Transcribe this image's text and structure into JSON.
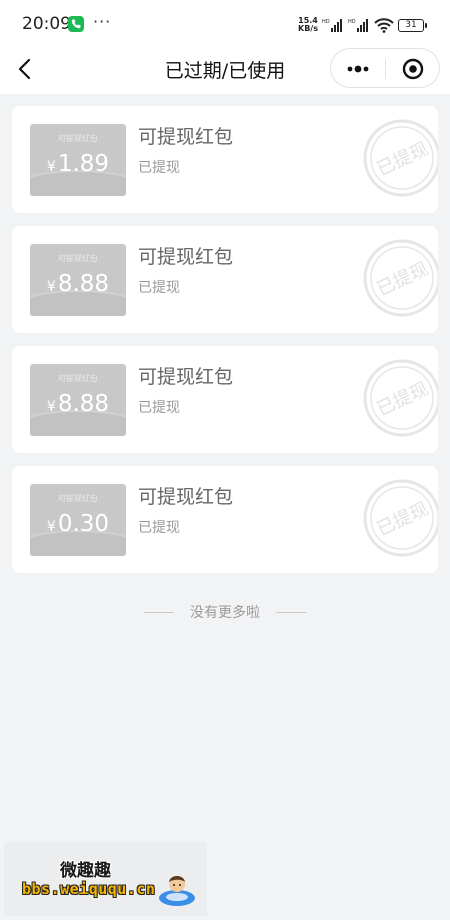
{
  "status_bar": {
    "time": "20:09",
    "dots": "···",
    "net_speed_value": "15.4",
    "net_speed_unit": "KB/s",
    "battery": "31"
  },
  "nav": {
    "title": "已过期/已使用"
  },
  "cards": [
    {
      "ticket_label": "可提现红包",
      "currency": "¥",
      "amount": "1.89",
      "title": "可提现红包",
      "status": "已提现",
      "stamp_text": "已提现"
    },
    {
      "ticket_label": "可提现红包",
      "currency": "¥",
      "amount": "8.88",
      "title": "可提现红包",
      "status": "已提现",
      "stamp_text": "已提现"
    },
    {
      "ticket_label": "可提现红包",
      "currency": "¥",
      "amount": "8.88",
      "title": "可提现红包",
      "status": "已提现",
      "stamp_text": "已提现"
    },
    {
      "ticket_label": "可提现红包",
      "currency": "¥",
      "amount": "0.30",
      "title": "可提现红包",
      "status": "已提现",
      "stamp_text": "已提现"
    }
  ],
  "end_text": "没有更多啦",
  "watermark": {
    "title": "微趣趣",
    "url": "bbs.weiququ.cn"
  },
  "colors": {
    "background": "#f2f3f5",
    "card": "#ffffff",
    "ticket": "#c8c8c8",
    "phone_badge": "#1db954",
    "watermark_url": "#f6b400"
  },
  "icons": [
    "phone-icon",
    "signal-icon",
    "wifi-icon",
    "battery-icon",
    "back-icon",
    "more-icon",
    "close-icon",
    "stamp-icon"
  ]
}
